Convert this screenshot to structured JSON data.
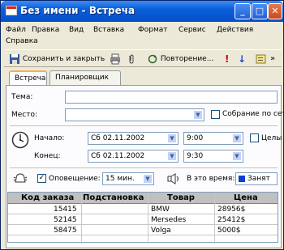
{
  "window": {
    "title": "Без имени - Встреча",
    "buttons": {
      "minimize": "_",
      "maximize": "□",
      "close": "✕"
    }
  },
  "menu": {
    "items": [
      "Файл",
      "Правка",
      "Вид",
      "Вставка",
      "Формат",
      "Сервис",
      "Действия",
      "Справка"
    ]
  },
  "toolbar": {
    "save_close": "Сохранить и закрыть",
    "recurrence": "Повторение...",
    "importance_high": "!",
    "importance_low": "↓"
  },
  "tabs": [
    {
      "label": "Встреча",
      "active": true
    },
    {
      "label": "Планировщик",
      "active": false
    }
  ],
  "form": {
    "subject_label": "Тема:",
    "subject_value": "",
    "location_label": "Место:",
    "location_value": "",
    "online_meeting_label": "Собрание по сет",
    "start_label": "Начало:",
    "start_date": "Сб 02.11.2002",
    "start_time": "9:00",
    "all_day_label": "Целы",
    "end_label": "Конец:",
    "end_date": "Сб 02.11.2002",
    "end_time": "9:30",
    "reminder_label": "Оповещение:",
    "reminder_checked": true,
    "reminder_value": "15 мин.",
    "show_as_label": "В это время:",
    "show_as_value": "Занят"
  },
  "table": {
    "columns": [
      "Код заказа",
      "Подстановка",
      "Товар",
      "Цена"
    ],
    "rows": [
      [
        "15415",
        "",
        "BMW",
        "28956$"
      ],
      [
        "52145",
        "",
        "Mersedes",
        "25412$"
      ],
      [
        "58475",
        "",
        "Volga",
        "5000$"
      ]
    ]
  },
  "colors": {
    "titlebar": "#0a5fd8",
    "window_bg": "#ece9d8",
    "tab_highlight": "#f0b44a",
    "show_as_swatch": "#0a3fd0"
  }
}
